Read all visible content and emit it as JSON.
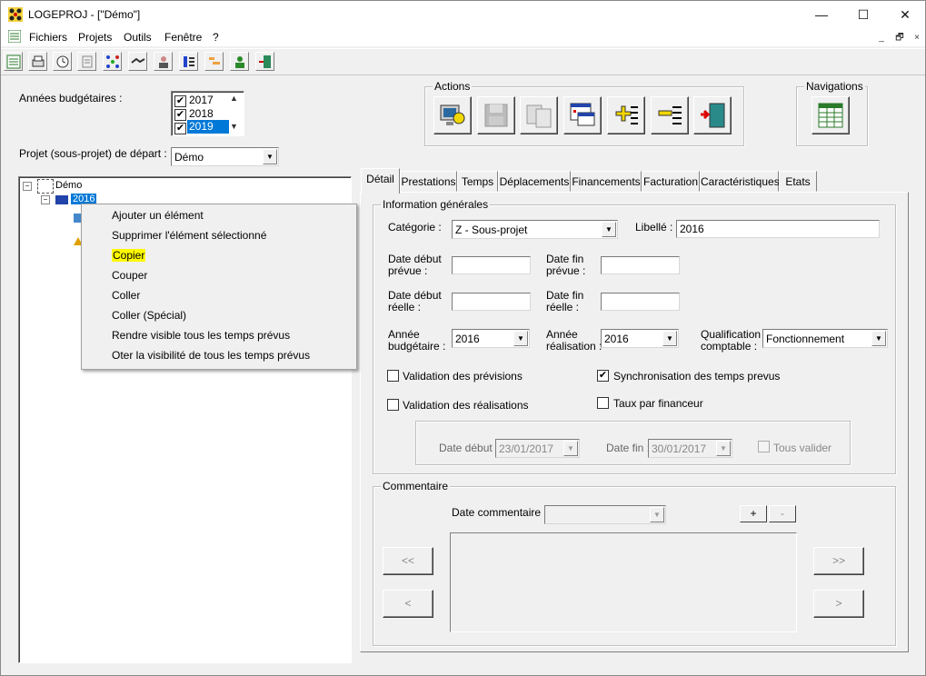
{
  "window": {
    "title": "LOGEPROJ - [\"Démo\"]",
    "minimize": "—",
    "maximize": "☐",
    "close": "✕"
  },
  "menu": {
    "items": [
      "Fichiers",
      "Projets",
      "Outils",
      "Fenêtre",
      "?"
    ],
    "mdi": [
      "_",
      "🗗",
      "×"
    ]
  },
  "toolbar": {
    "icons": [
      "list-icon",
      "printer-icon",
      "clock-icon",
      "document-icon",
      "network-icon",
      "handshake-icon",
      "user-icon",
      "hierarchy-icon",
      "gantt-icon",
      "people-icon",
      "exit-icon"
    ]
  },
  "budget_years": {
    "label": "Années budgétaires :",
    "items": [
      {
        "year": "2017",
        "checked": true,
        "selected": false
      },
      {
        "year": "2018",
        "checked": true,
        "selected": false
      },
      {
        "year": "2019",
        "checked": true,
        "selected": true
      }
    ]
  },
  "start_project": {
    "label": "Projet (sous-projet) de départ :",
    "value": "Démo"
  },
  "actions": {
    "title": "Actions",
    "buttons": [
      "monitor-settings-icon",
      "save-icon",
      "copy-doc-icon",
      "window-list-icon",
      "add-line-icon",
      "remove-line-icon",
      "exit-door-icon"
    ]
  },
  "navigations": {
    "title": "Navigations",
    "button": "table-icon"
  },
  "tree": {
    "root": "Démo",
    "child": "2016"
  },
  "context_menu": {
    "items": [
      "Ajouter un élément",
      "Supprimer l'élément sélectionné",
      "Copier",
      "Couper",
      "Coller",
      "Coller (Spécial)",
      "Rendre visible tous les temps prévus",
      "Oter la visibilité de tous les temps prévus"
    ],
    "highlighted_index": 2
  },
  "tabs": [
    "Détail",
    "Prestations",
    "Temps",
    "Déplacements",
    "Financements",
    "Facturation",
    "Caractéristiques",
    "Etats"
  ],
  "active_tab": "Détail",
  "general_info": {
    "title": "Information générales",
    "category_label": "Catégorie  :",
    "category_value": "Z - Sous-projet",
    "libelle_label": "Libellé  :",
    "libelle_value": "2016",
    "date_debut_prevue_label_1": "Date début",
    "date_debut_prevue_label_2": "prévue :",
    "date_fin_prevue_label_1": "Date fin",
    "date_fin_prevue_label_2": "prévue :",
    "date_debut_reelle_label_1": "Date début",
    "date_debut_reelle_label_2": "réelle :",
    "date_fin_reelle_label_1": "Date fin",
    "date_fin_reelle_label_2": "réelle :",
    "annee_budgetaire_label_1": "Année",
    "annee_budgetaire_label_2": "budgétaire :",
    "annee_budgetaire_value": "2016",
    "annee_realisation_label_1": "Année",
    "annee_realisation_label_2": "réalisation :",
    "annee_realisation_value": "2016",
    "qualification_label_1": "Qualification",
    "qualification_label_2": "comptable :",
    "qualification_value": "Fonctionnement",
    "validation_previsions": {
      "label": "Validation des prévisions",
      "checked": false
    },
    "synchronisation": {
      "label": "Synchronisation des temps prevus",
      "checked": true
    },
    "validation_realisations": {
      "label": "Validation des réalisations",
      "checked": false
    },
    "taux_financeur": {
      "label": "Taux par financeur",
      "checked": false
    },
    "date_debut_label": "Date début :",
    "date_debut_value": "23/01/2017",
    "date_fin_label": "Date fin :",
    "date_fin_value": "30/01/2017",
    "tous_valider": {
      "label": "Tous valider",
      "checked": false
    }
  },
  "comment": {
    "title": "Commentaire",
    "date_label": "Date commentaire :",
    "date_value": "",
    "add": "+",
    "remove": "-",
    "first": "<<",
    "prev": "<",
    "last": ">>",
    "next": ">"
  }
}
